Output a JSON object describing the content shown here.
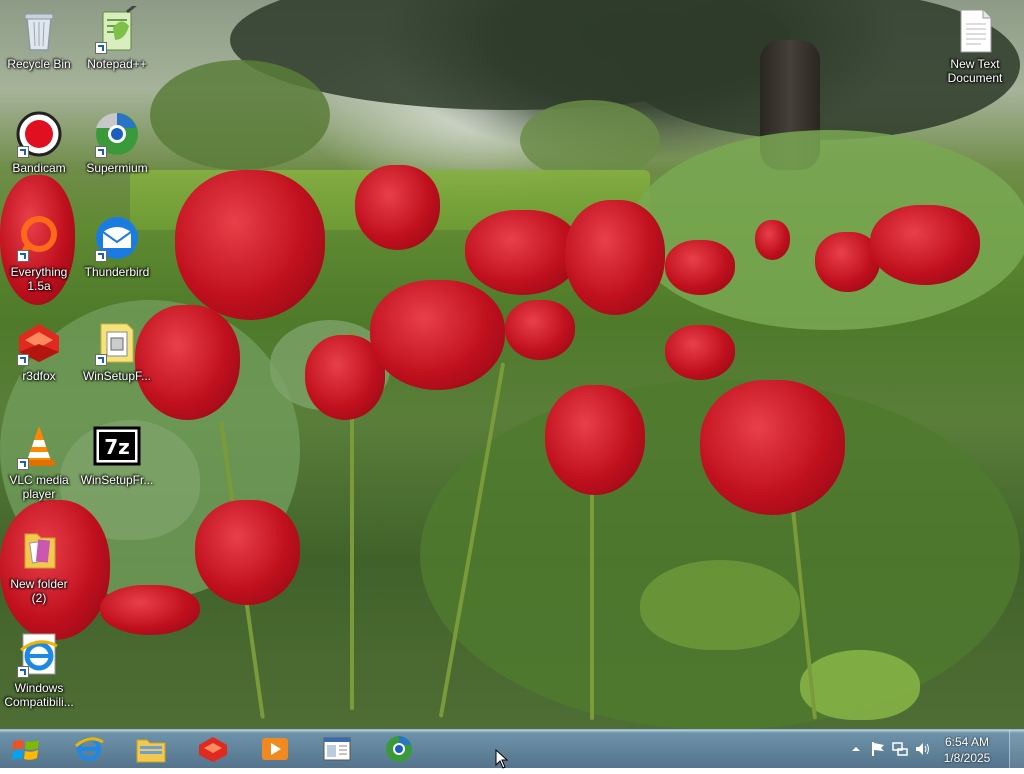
{
  "desktop": {
    "icons": [
      {
        "name": "Recycle Bin"
      },
      {
        "name": "Notepad++"
      },
      {
        "name": "Bandicam"
      },
      {
        "name": "Supermium"
      },
      {
        "name": "Everything\n1.5a"
      },
      {
        "name": "Thunderbird"
      },
      {
        "name": "r3dfox"
      },
      {
        "name": "WinSetupF..."
      },
      {
        "name": "VLC media\nplayer"
      },
      {
        "name": "WinSetupFr..."
      },
      {
        "name": "New folder\n(2)"
      },
      {
        "name": "Windows\nCompatibili..."
      },
      {
        "name": "New Text\nDocument"
      }
    ]
  },
  "taskbar": {
    "pinned": [
      {
        "icon": "internet-explorer-icon"
      },
      {
        "icon": "file-explorer-icon"
      },
      {
        "icon": "r3dfox-icon"
      },
      {
        "icon": "media-player-icon"
      },
      {
        "icon": "window-icon"
      },
      {
        "icon": "supermium-icon"
      }
    ],
    "clock": {
      "time": "6:54 AM",
      "date": "1/8/2025"
    }
  },
  "colors": {
    "accent": "#1a5fc0",
    "tulip_red": "#c0101e"
  }
}
